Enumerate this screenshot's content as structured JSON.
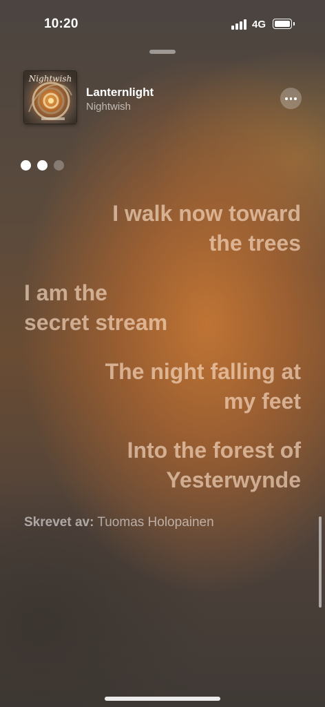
{
  "status_bar": {
    "time": "10:20",
    "network": "4G",
    "icons": [
      "signal-bars-icon",
      "battery-icon"
    ]
  },
  "now_playing": {
    "title": "Lanternlight",
    "artist": "Nightwish",
    "artwork": "album-artwork",
    "more_icon": "ellipsis-icon"
  },
  "pager": {
    "count": 3,
    "active": [
      0,
      1
    ]
  },
  "lyrics": [
    {
      "lines": [
        "I walk now toward",
        "the trees"
      ],
      "align": "right"
    },
    {
      "lines": [
        "I am the",
        "secret stream"
      ],
      "align": "left"
    },
    {
      "lines": [
        "The night falling at",
        "my feet"
      ],
      "align": "right"
    },
    {
      "lines": [
        "Into the forest of",
        "Yesterwynde"
      ],
      "align": "right"
    }
  ],
  "credits": {
    "label": "Skrevet av:",
    "value": "Tuomas Holopainen"
  },
  "colors": {
    "accent_orange": "#c4763a",
    "background_dark": "#3f3935",
    "lyric_text": "#ffe4cd"
  }
}
